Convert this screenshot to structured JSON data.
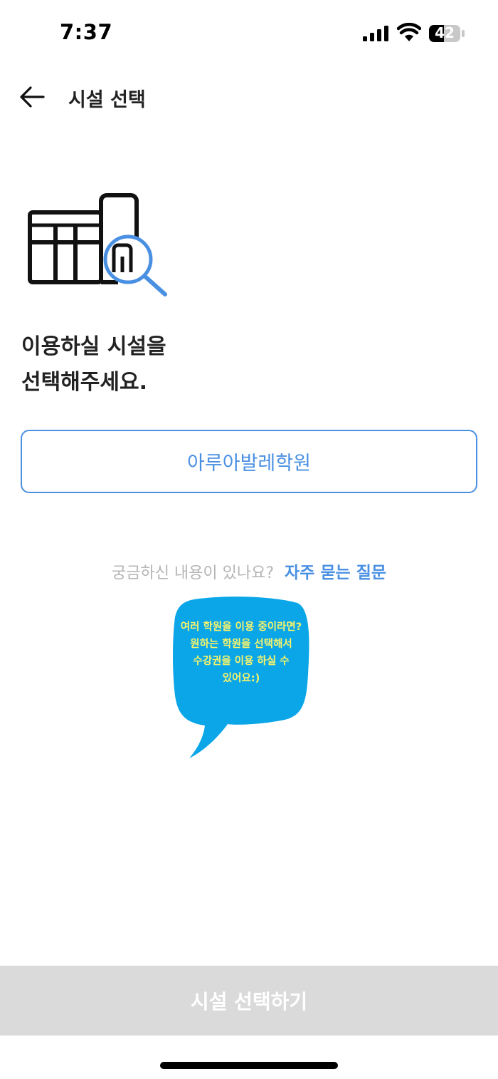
{
  "status_bar": {
    "time": "7:37",
    "battery": "42",
    "icons": [
      "signal-icon",
      "wifi-icon",
      "battery-icon"
    ]
  },
  "header": {
    "back_icon": "arrow-left-icon",
    "title": "시설 선택"
  },
  "illustration": {
    "icon": "facility-search-icon",
    "accent_color": "#4a90e2"
  },
  "prompt": {
    "line1": "이용하실 시설을",
    "line2": "선택해주세요."
  },
  "facility_option": {
    "label": "아루아발레학원",
    "color": "#4a90e2"
  },
  "faq": {
    "question": "궁금하신 내용이 있나요?",
    "link": "자주 묻는 질문"
  },
  "speech_bubble": {
    "text": "여러 학원을 이용 중이라면? 원하는 학원을 선택해서 수강권을 이용 하실 수 있어요:)",
    "bubble_color": "#0aa6e8",
    "text_color": "#f8f46a"
  },
  "bottom_button": {
    "label": "시설 선택하기",
    "disabled_color": "#dadada"
  }
}
